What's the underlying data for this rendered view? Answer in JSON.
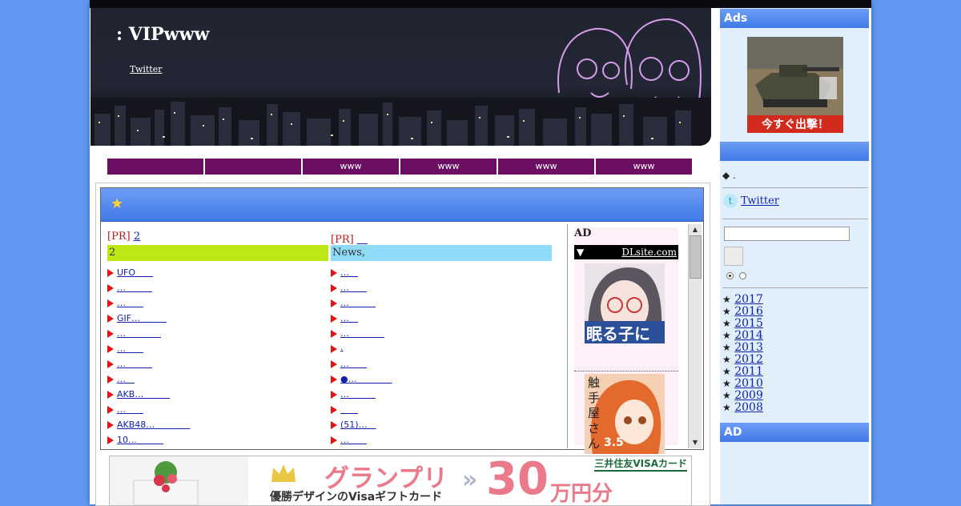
{
  "header": {
    "site_title": ": VIPwww",
    "twitter_link": "Twitter"
  },
  "nav": {
    "tabs": [
      "",
      "",
      "www",
      "www",
      "www",
      "www"
    ]
  },
  "main": {
    "star": "★",
    "left_column": {
      "pr_label": "[PR]",
      "pr_link": "2",
      "category": "2",
      "category_color": "#bde815",
      "items": [
        "UFO　　",
        "…　　　",
        "…　　",
        "GIF…　　　",
        "…　　　　",
        "…　　",
        "…　　　",
        "…　",
        "AKB…　　　",
        "…　　",
        "AKB48…　　　　",
        "10…　　　"
      ]
    },
    "right_column": {
      "pr_label": "[PR]",
      "pr_link": "　",
      "category": "News,",
      "category_color": "#8fdaf7",
      "items": [
        "…　",
        "…　　",
        "…　　　",
        "…　",
        "…　　　　",
        ".",
        "…　　",
        "●…　　　　",
        "…　　　",
        "　　",
        "(51)…　",
        "…　　"
      ]
    },
    "ad_column": {
      "title": "AD",
      "triangle": "▼",
      "source": "DLsite.com",
      "thumb1_text": "眠る子に",
      "thumb2_text": "触手屋さん",
      "thumb2_num": "3.5"
    }
  },
  "bottom_ad": {
    "headline": "グランプリ",
    "subline": "優勝デザインのVisaギフトカード",
    "arrows": "»",
    "amount": "30",
    "unit": "万円分",
    "brand": "三井住友VISAカード"
  },
  "sidebar": {
    "ads_title": "Ads",
    "tank_button": "今すぐ出撃！",
    "section_blank": "",
    "bullet_text": "◆ .",
    "twitter_label": " Twitter ",
    "years": [
      "2017",
      "2016",
      "2015",
      "2014",
      "2013",
      "2012",
      "2011",
      "2010",
      "2009",
      "2008"
    ],
    "year_star": "★",
    "ad_title": "AD"
  },
  "colors": {
    "background": "#5f97f2",
    "nav_tab": "#6c0f62",
    "header_gradient_top": "#6e9df5",
    "header_gradient_bottom": "#3f7ae8",
    "sidebar_bg": "#e1eefc"
  }
}
